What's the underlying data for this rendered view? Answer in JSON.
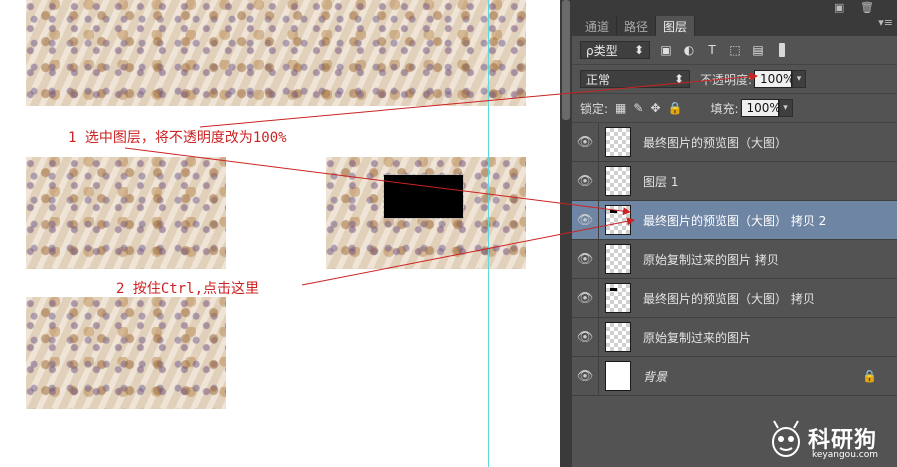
{
  "panel": {
    "tabs": [
      {
        "label": "通道",
        "active": false
      },
      {
        "label": "路径",
        "active": false
      },
      {
        "label": "图层",
        "active": true
      }
    ],
    "filter": {
      "kind_label": "ρ类型"
    },
    "blend": {
      "mode": "正常",
      "opacity_label": "不透明度:",
      "opacity_value": "100%"
    },
    "lock": {
      "label": "锁定:",
      "fill_label": "填充:",
      "fill_value": "100%"
    },
    "layers": [
      {
        "name": "最终图片的预览图（大图）",
        "selected": false,
        "thumb": "transparent"
      },
      {
        "name": "图层 1",
        "selected": false,
        "thumb": "transparent"
      },
      {
        "name": "最终图片的预览图（大图） 拷贝 2",
        "selected": true,
        "thumb": "transparent-marked"
      },
      {
        "name": "原始复制过来的图片 拷贝",
        "selected": false,
        "thumb": "transparent"
      },
      {
        "name": "最终图片的预览图（大图） 拷贝",
        "selected": false,
        "thumb": "transparent-marked"
      },
      {
        "name": "原始复制过来的图片",
        "selected": false,
        "thumb": "transparent"
      },
      {
        "name": "背景",
        "selected": false,
        "thumb": "white",
        "locked": true
      }
    ]
  },
  "annotations": {
    "step1": "1 选中图层，将不透明度改为100%",
    "step2": "2 按住Ctrl,点击这里"
  },
  "watermark": {
    "brand": "科研狗",
    "url": "keyangou.com"
  },
  "colors": {
    "annotation": "#cc2222",
    "panel_bg": "#535353",
    "selected_layer": "#6f85a4",
    "guide": "#5fd9e0"
  }
}
